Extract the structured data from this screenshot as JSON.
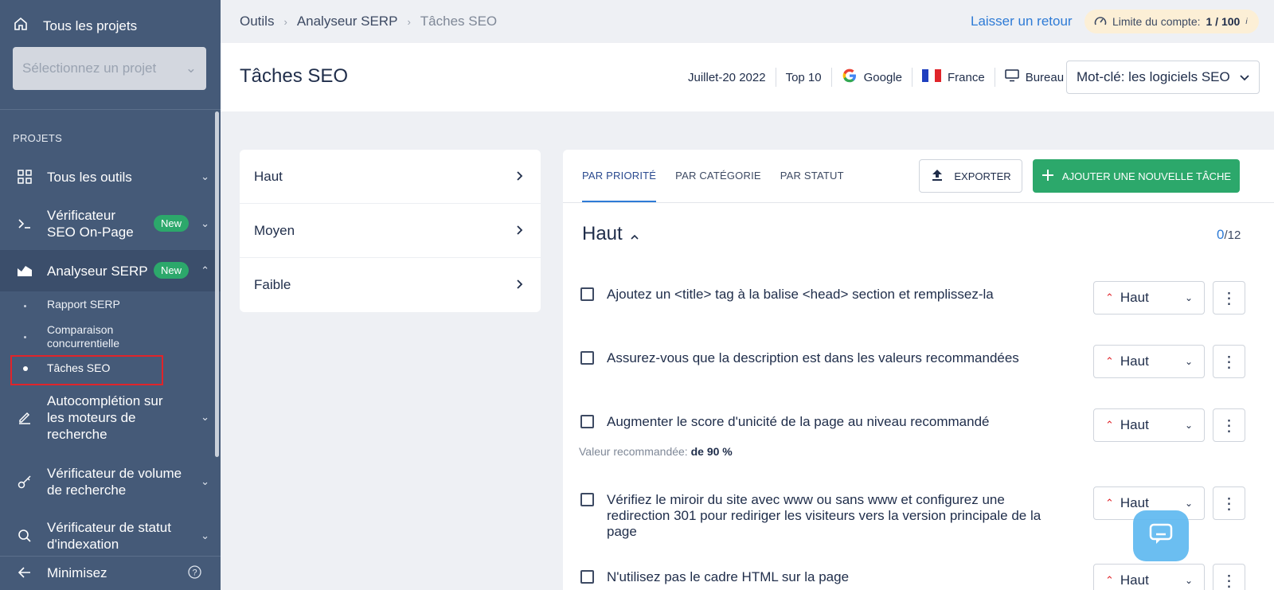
{
  "sidebar": {
    "all_projects": "Tous les projets",
    "project_select_placeholder": "Sélectionnez un projet",
    "section_label": "PROJETS",
    "items": [
      {
        "label": "Tous les outils"
      },
      {
        "label": "Vérificateur SEO On-Page",
        "badge": "New"
      },
      {
        "label": "Analyseur SERP",
        "badge": "New"
      },
      {
        "label": "Autocomplétion sur les moteurs de recherche"
      },
      {
        "label": "Vérificateur de volume de recherche"
      },
      {
        "label": "Vérificateur de statut d'indexation"
      }
    ],
    "sub_items": [
      "Rapport SERP",
      "Comparaison concurrentielle",
      "Tâches SEO"
    ],
    "minimize": "Minimisez"
  },
  "topbar": {
    "breadcrumb": [
      "Outils",
      "Analyseur SERP",
      "Tâches SEO"
    ],
    "feedback": "Laisser un retour",
    "limit_label": "Limite du compte:",
    "limit_value": "1 / 100"
  },
  "header": {
    "title": "Tâches SEO",
    "date": "Juillet-20 2022",
    "top": "Top 10",
    "engine": "Google",
    "country": "France",
    "device": "Bureau",
    "keyword_select": "Mot-clé: les logiciels SEO"
  },
  "priorities": [
    "Haut",
    "Moyen",
    "Faible"
  ],
  "tabs": [
    "PAR PRIORITÉ",
    "PAR CATÉGORIE",
    "PAR STATUT"
  ],
  "buttons": {
    "export": "EXPORTER",
    "add_task": "AJOUTER UNE NOUVELLE TÂCHE"
  },
  "group": {
    "title": "Haut",
    "done": "0",
    "total": "/12"
  },
  "tasks": [
    {
      "text": "Ajoutez un <title> tag à la balise <head> section et remplissez-la",
      "priority": "Haut"
    },
    {
      "text": "Assurez-vous que la description est dans les valeurs recommandées",
      "priority": "Haut"
    },
    {
      "text": "Augmenter le score d'unicité de la page au niveau recommandé",
      "priority": "Haut",
      "rec_label": "Valeur recommandée:",
      "rec_value": "de 90 %"
    },
    {
      "text": "Vérifiez le miroir du site avec www ou sans www et configurez une redirection 301 pour rediriger les visiteurs vers la version principale de la page",
      "priority": "Haut"
    },
    {
      "text": "N'utilisez pas le cadre HTML sur la page",
      "priority": "Haut"
    }
  ],
  "colors": {
    "sidebar_bg": "#455a78",
    "accent_green": "#2ca86b",
    "link_blue": "#2e7bd6",
    "highlight_red": "#e0242a"
  }
}
